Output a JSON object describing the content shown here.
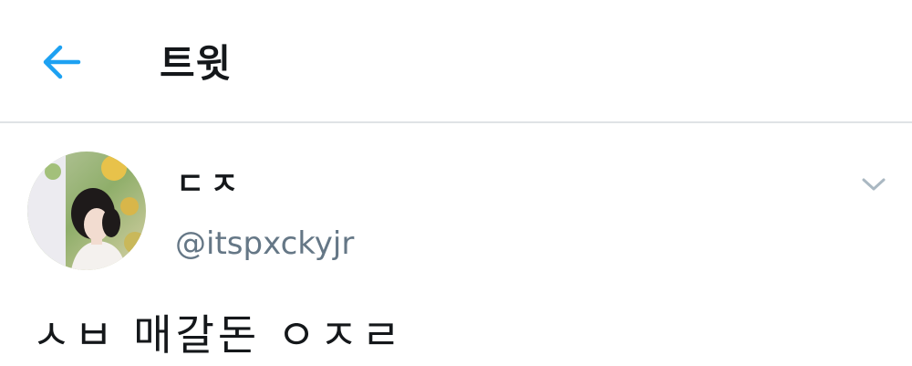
{
  "header": {
    "title": "트윗",
    "back_icon": "arrow-left-icon",
    "accent_color": "#1da1f2"
  },
  "tweet": {
    "display_name": "ㄷㅈ",
    "handle": "@itspxckyjr",
    "text": "ㅅㅂ 매갈돈 ㅇㅈㄹ",
    "menu_icon": "chevron-down-icon"
  }
}
